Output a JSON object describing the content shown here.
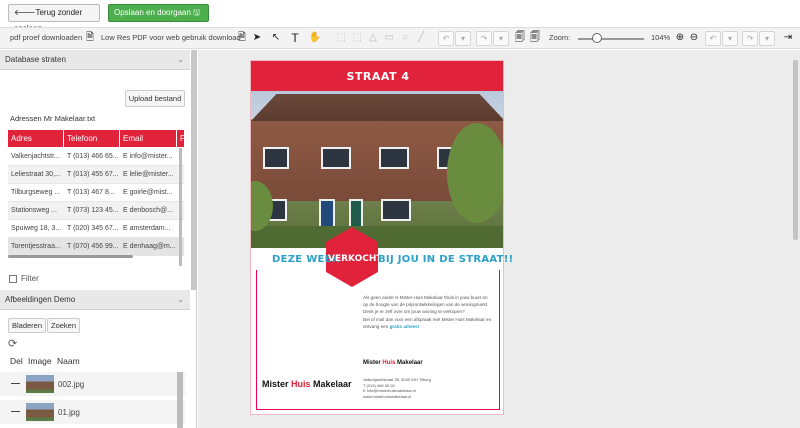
{
  "topbar": {
    "back_label": "🡐Terug zonder opslaan",
    "save_label": "Opslaan en doorgaan 🖫 ➔"
  },
  "toolbar": {
    "pdf_proof_label": "pdf proef downloaden",
    "low_res_label": "Low Res PDF voor web gebruik download",
    "zoom_label": "Zoom:",
    "zoom_value": "104%"
  },
  "left": {
    "db_section_title": "Database straten",
    "upload_label": "Upload bestand",
    "filename": "Adressen Mr Makelaar.txt",
    "columns": [
      "Adres",
      "Telefoon",
      "Email",
      "F"
    ],
    "rows": [
      [
        "Valkenjachtstr...",
        "T (013) 466 65...",
        "E info@mister...",
        ""
      ],
      [
        "Leliestraat 30,...",
        "T (013) 455 67...",
        "E lelie@mister...",
        ""
      ],
      [
        "Tilburgseweg ...",
        "T (013)  467 8...",
        "E goirle@mist...",
        ""
      ],
      [
        "Stationsweg ...",
        "T (073) 123 45...",
        "E denbosch@...",
        ""
      ],
      [
        "Spuiweg 18, 3...",
        "T (020) 345 67...",
        "E amsterdam...",
        ""
      ],
      [
        "Torentjesstraa...",
        "T (070) 456 99...",
        "E denhaag@m...",
        ""
      ]
    ],
    "filter_label": "Filter",
    "images_section_title": "Afbeeldingen Demo",
    "browse_label": "Bladeren",
    "search_label": "Zoeken",
    "images_columns": [
      "Del",
      "Image",
      "Naam"
    ],
    "images": [
      {
        "name": "002.jpg"
      },
      {
        "name": "01.jpg"
      }
    ]
  },
  "flyer": {
    "title": "STRAAT 4",
    "tag_left": "DEZE WEEK",
    "tag_mid": "VERKOCHT",
    "tag_right": "BIJ JOU IN DE STRAAT!!",
    "body_1": "Als geen ander is Mister Huis Makelaar thuis in jouw buurt en op de hoogte van de prijsontwikkelingen van de woningmarkt.",
    "body_2": "Denk je er zelf over om jouw woning te verkopen?",
    "body_3": "Bel of mail dan voor een afspraak met Mister Huis Makelaar en ontvang een",
    "body_link": "gratis advies!",
    "logo_part1": "Mister ",
    "logo_part2": "Huis",
    "logo_part3": " Makelaar",
    "addr_1": "Valkenjachtstraat 35, 5045 WH Tilburg",
    "addr_2": "T (013) 466 65 00",
    "addr_3": "E info@misterhuismakelaar.nl",
    "addr_4": "www.misterhuismakelaar.nl"
  }
}
